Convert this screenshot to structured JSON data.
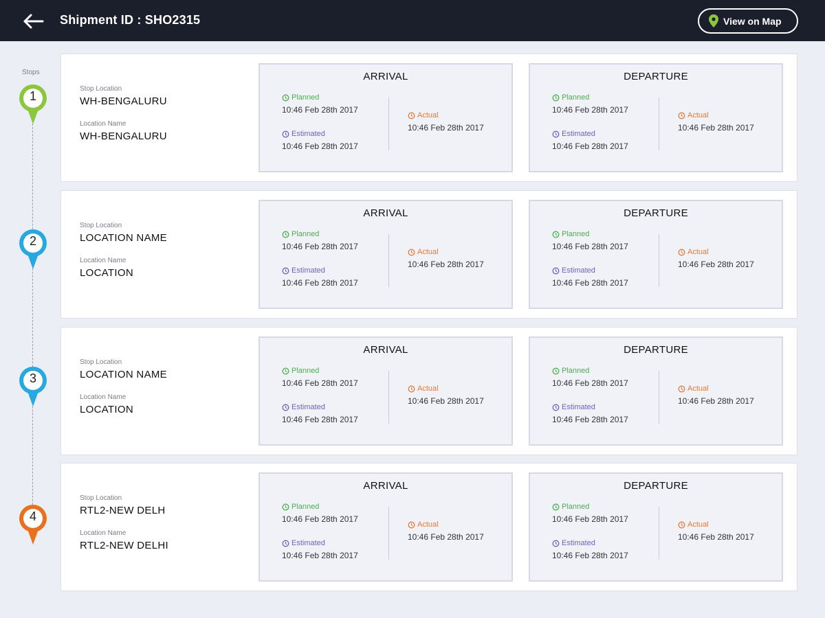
{
  "header": {
    "title": "Shipment ID : SHO2315",
    "map_button": "View on Map"
  },
  "stops_label": "Stops",
  "labels": {
    "stop_location": "Stop Location",
    "location_name": "Location Name",
    "arrival": "ARRIVAL",
    "departure": "DEPARTURE",
    "planned": "Planned",
    "estimated": "Estimated",
    "actual": "Actual"
  },
  "colors": {
    "stop_1": "#8cc63f",
    "stop_2": "#29a8e0",
    "stop_3": "#29a8e0",
    "stop_4": "#e8711e",
    "planned": "#4cae4c",
    "estimated": "#6f5fbf",
    "actual": "#e07b39"
  },
  "stops": [
    {
      "number": "1",
      "stop_location": "WH-BENGALURU",
      "location_name": "WH-BENGALURU",
      "arrival": {
        "planned": "10:46 Feb 28th 2017",
        "estimated": "10:46 Feb 28th 2017",
        "actual": "10:46 Feb 28th 2017"
      },
      "departure": {
        "planned": "10:46 Feb 28th 2017",
        "estimated": "10:46 Feb 28th 2017",
        "actual": "10:46 Feb 28th 2017"
      }
    },
    {
      "number": "2",
      "stop_location": "LOCATION NAME",
      "location_name": "LOCATION",
      "arrival": {
        "planned": "10:46 Feb 28th 2017",
        "estimated": "10:46 Feb 28th 2017",
        "actual": "10:46 Feb 28th 2017"
      },
      "departure": {
        "planned": "10:46 Feb 28th 2017",
        "estimated": "10:46 Feb 28th 2017",
        "actual": "10:46 Feb 28th 2017"
      }
    },
    {
      "number": "3",
      "stop_location": "LOCATION NAME",
      "location_name": "LOCATION",
      "arrival": {
        "planned": "10:46 Feb 28th 2017",
        "estimated": "10:46 Feb 28th 2017",
        "actual": "10:46 Feb 28th 2017"
      },
      "departure": {
        "planned": "10:46 Feb 28th 2017",
        "estimated": "10:46 Feb 28th 2017",
        "actual": "10:46 Feb 28th 2017"
      }
    },
    {
      "number": "4",
      "stop_location": "RTL2-NEW DELH",
      "location_name": "RTL2-NEW DELHI",
      "arrival": {
        "planned": "10:46 Feb 28th 2017",
        "estimated": "10:46 Feb 28th 2017",
        "actual": "10:46 Feb 28th 2017"
      },
      "departure": {
        "planned": "10:46 Feb 28th 2017",
        "estimated": "10:46 Feb 28th 2017",
        "actual": "10:46 Feb 28th 2017"
      }
    }
  ]
}
